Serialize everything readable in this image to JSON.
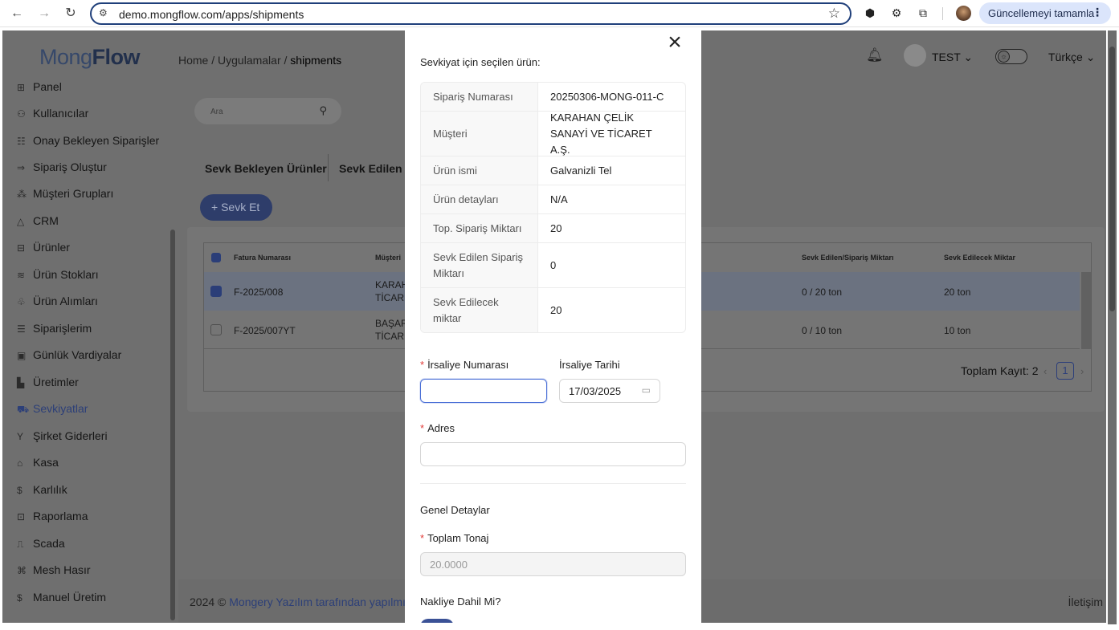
{
  "browser": {
    "url": "demo.mongflow.com/apps/shipments",
    "update_label": "Güncellemeyi tamamla"
  },
  "app": {
    "logo_light": "Mong",
    "logo_bold": "Flow",
    "breadcrumb": {
      "home": "Home",
      "sep": "/",
      "apps": "Uygulamalar",
      "current": "shipments"
    },
    "user": "TEST",
    "language": "Türkçe"
  },
  "sidebar": {
    "items": [
      {
        "label": "Panel",
        "icon": "grid-icon"
      },
      {
        "label": "Kullanıcılar",
        "icon": "users-icon"
      },
      {
        "label": "Onay Bekleyen Siparişler",
        "icon": "list-icon"
      },
      {
        "label": "Sipariş Oluştur",
        "icon": "arrow-right-icon"
      },
      {
        "label": "Müşteri Grupları",
        "icon": "cluster-icon"
      },
      {
        "label": "CRM",
        "icon": "crm-icon"
      },
      {
        "label": "Ürünler",
        "icon": "table-icon"
      },
      {
        "label": "Ürün Stokları",
        "icon": "layers-icon"
      },
      {
        "label": "Ürün Alımları",
        "icon": "gift-icon"
      },
      {
        "label": "Siparişlerim",
        "icon": "ordered-list-icon"
      },
      {
        "label": "Günlük Vardiyalar",
        "icon": "calendar-icon"
      },
      {
        "label": "Üretimler",
        "icon": "factory-icon"
      },
      {
        "label": "Sevkiyatlar",
        "icon": "truck-icon"
      },
      {
        "label": "Şirket Giderleri",
        "icon": "fork-icon"
      },
      {
        "label": "Kasa",
        "icon": "bank-icon"
      },
      {
        "label": "Karlılık",
        "icon": "dollar-icon"
      },
      {
        "label": "Raporlama",
        "icon": "report-icon"
      },
      {
        "label": "Scada",
        "icon": "tv-icon"
      },
      {
        "label": "Mesh Hasır",
        "icon": "mesh-icon"
      },
      {
        "label": "Manuel Üretim",
        "icon": "dollar-icon"
      }
    ]
  },
  "main": {
    "search_placeholder": "Ara",
    "tabs": [
      "Sevk Bekleyen Ürünler",
      "Sevk Edilen Ü"
    ],
    "add_button": "+ Sevk Et",
    "table": {
      "headers": [
        "Fatura Numarası",
        "Müşteri",
        "Sevk Edilen/Sipariş Miktarı",
        "Sevk Edilecek Miktar"
      ],
      "rows": [
        {
          "invoice": "F-2025/008",
          "customer_1": "KARAH",
          "customer_2": "TİCARE",
          "ratio": "0 / 20 ton",
          "remaining": "20 ton"
        },
        {
          "invoice": "F-2025/007YT",
          "customer_1": "BAŞAR",
          "customer_2": "TİCARE",
          "ratio": "0 / 10 ton",
          "remaining": "10 ton"
        }
      ],
      "total_label": "Toplam Kayıt: 2",
      "page": "1"
    },
    "footer_prefix": "2024 ©",
    "footer_link": "Mongery Yazılım tarafından yapılmıştı",
    "footer_right": "İletişim"
  },
  "drawer": {
    "title": "Sevkiyat için seçilen ürün:",
    "details": [
      {
        "label": "Sipariş Numarası",
        "value": "20250306-MONG-011-C"
      },
      {
        "label": "Müşteri",
        "value": "KARAHAN ÇELİK SANAYİ VE TİCARET A.Ş."
      },
      {
        "label": "Ürün ismi",
        "value": "Galvanizli Tel"
      },
      {
        "label": "Ürün detayları",
        "value": "N/A"
      },
      {
        "label": "Top. Sipariş Miktarı",
        "value": "20"
      },
      {
        "label": "Sevk Edilen Sipariş Miktarı",
        "value": "0"
      },
      {
        "label": "Sevk Edilecek miktar",
        "value": "20"
      }
    ],
    "irsaliye_no_label": "İrsaliye Numarası",
    "irsaliye_no_value": "",
    "irsaliye_date_label": "İrsaliye Tarihi",
    "irsaliye_date_value": "17/03/2025",
    "address_label": "Adres",
    "address_value": "",
    "section_title": "Genel Detaylar",
    "tonnage_label": "Toplam Tonaj",
    "tonnage_value": "20.0000",
    "transport_label": "Nakliye Dahil Mi?",
    "transport_on": true
  }
}
